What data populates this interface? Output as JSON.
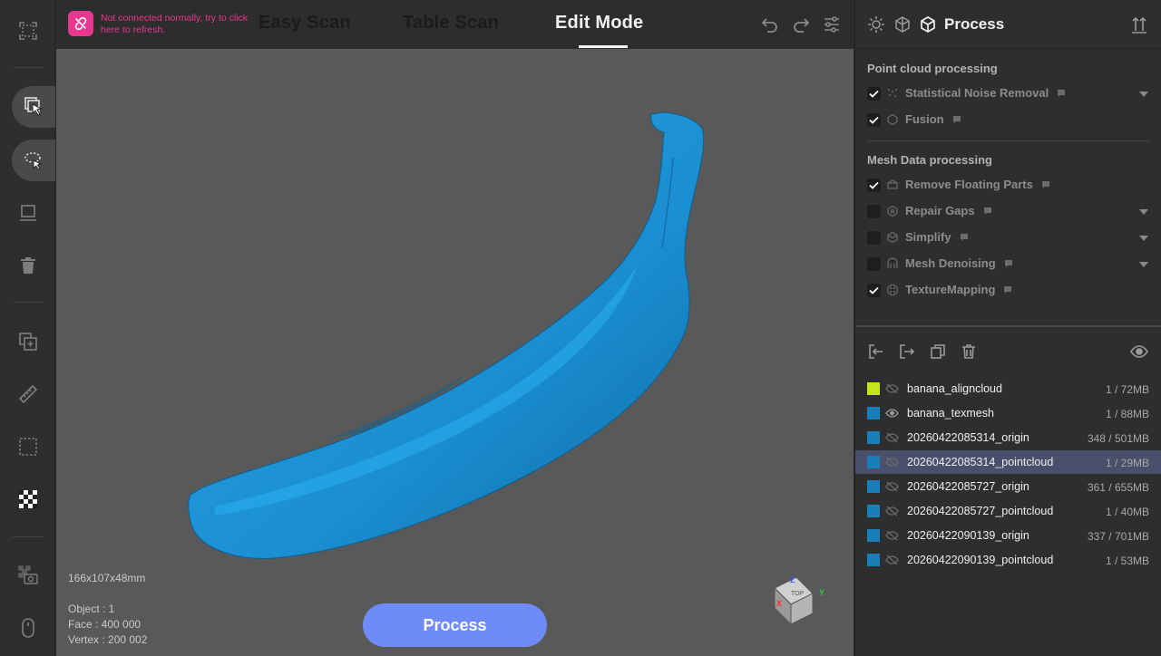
{
  "topbar": {
    "warning": "Not connected normally, try to click here to refresh.",
    "tabs": [
      {
        "label": "Easy Scan",
        "active": false
      },
      {
        "label": "Table Scan",
        "active": false
      },
      {
        "label": "Edit Mode",
        "active": true
      }
    ],
    "icons": [
      "undo-icon",
      "redo-icon",
      "settings-sliders-icon"
    ]
  },
  "left_toolbar": {
    "tools": [
      "fullscreen-icon",
      "select-tool-icon",
      "lasso-select-icon",
      "screen-icon",
      "trash-icon",
      "duplicate-add-icon",
      "ruler-icon",
      "crop-box-icon",
      "checkerboard-texture-icon",
      "screenshot-icon",
      "mouse-icon"
    ]
  },
  "viewport": {
    "dimensions": "166x107x48mm",
    "object": "Object : 1",
    "face": "Face : 400 000",
    "vertex": "Vertex : 200 002",
    "process_button": "Process",
    "gizmo": {
      "z": "Z",
      "y": "Y",
      "x": "X",
      "face": "TOP"
    },
    "model_color": "#1a8ed1"
  },
  "right_panel": {
    "title": "Process",
    "header_icons": [
      "sun-icon",
      "texture-icon",
      "cube-process-icon",
      "sort-icon"
    ],
    "point_cloud_section": "Point cloud processing",
    "point_cloud_items": [
      {
        "label": "Statistical Noise Removal",
        "checked": true,
        "caret": true
      },
      {
        "label": "Fusion",
        "checked": true,
        "caret": false
      }
    ],
    "mesh_section": "Mesh Data processing",
    "mesh_items": [
      {
        "label": "Remove Floating Parts",
        "checked": true,
        "caret": false
      },
      {
        "label": "Repair Gaps",
        "checked": false,
        "caret": true
      },
      {
        "label": "Simplify",
        "checked": false,
        "caret": true
      },
      {
        "label": "Mesh Denoising",
        "checked": false,
        "caret": true
      },
      {
        "label": "TextureMapping",
        "checked": true,
        "caret": false
      }
    ],
    "library_icons": [
      "import-icon",
      "export-icon",
      "copy-icon",
      "delete-icon",
      "eye-icon"
    ],
    "objects": [
      {
        "name": "banana_aligncloud",
        "size": "1 / 72MB",
        "color": "#c5e51a",
        "visible": false,
        "selected": false
      },
      {
        "name": "banana_texmesh",
        "size": "1 / 88MB",
        "color": "#1a7fb8",
        "visible": true,
        "selected": false
      },
      {
        "name": "20260422085314_origin",
        "size": "348 / 501MB",
        "color": "#1a7fb8",
        "visible": false,
        "selected": false
      },
      {
        "name": "20260422085314_pointcloud",
        "size": "1 / 29MB",
        "color": "#1a7fb8",
        "visible": false,
        "selected": true
      },
      {
        "name": "20260422085727_origin",
        "size": "361 / 655MB",
        "color": "#1a7fb8",
        "visible": false,
        "selected": false
      },
      {
        "name": "20260422085727_pointcloud",
        "size": "1 / 40MB",
        "color": "#1a7fb8",
        "visible": false,
        "selected": false
      },
      {
        "name": "20260422090139_origin",
        "size": "337 / 701MB",
        "color": "#1a7fb8",
        "visible": false,
        "selected": false
      },
      {
        "name": "20260422090139_pointcloud",
        "size": "1 / 53MB",
        "color": "#1a7fb8",
        "visible": false,
        "selected": false
      }
    ]
  }
}
